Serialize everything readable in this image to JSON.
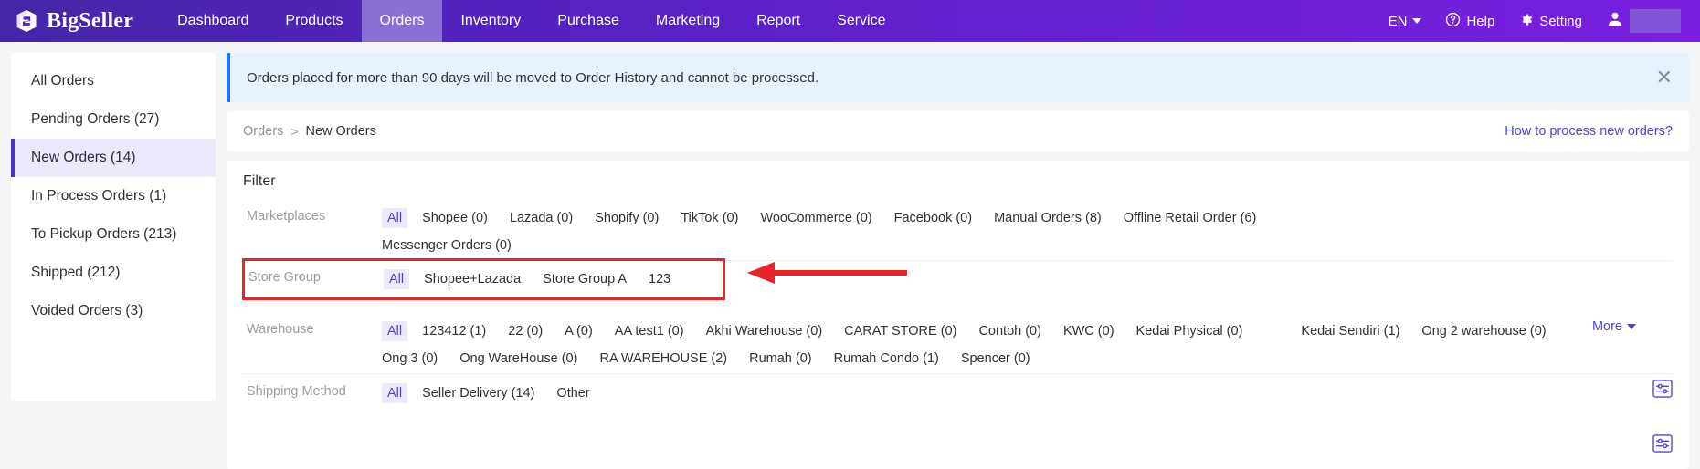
{
  "topnav": {
    "brand": "BigSeller",
    "brand_logo_icon": "bigseller-logo-icon",
    "items": [
      {
        "label": "Dashboard",
        "active": false
      },
      {
        "label": "Products",
        "active": false
      },
      {
        "label": "Orders",
        "active": true
      },
      {
        "label": "Inventory",
        "active": false
      },
      {
        "label": "Purchase",
        "active": false
      },
      {
        "label": "Marketing",
        "active": false
      },
      {
        "label": "Report",
        "active": false
      },
      {
        "label": "Service",
        "active": false
      }
    ],
    "language": "EN",
    "help": "Help",
    "setting": "Setting",
    "accent": "#5b21c9",
    "active_tab_bg": "#8a6fd4"
  },
  "sidebar": {
    "items": [
      {
        "label": "All Orders",
        "active": false
      },
      {
        "label": "Pending Orders (27)",
        "active": false
      },
      {
        "label": "New Orders (14)",
        "active": true
      },
      {
        "label": "In Process Orders (1)",
        "active": false
      },
      {
        "label": "To Pickup Orders (213)",
        "active": false
      },
      {
        "label": "Shipped (212)",
        "active": false
      },
      {
        "label": "Voided Orders (3)",
        "active": false
      }
    ],
    "active_bg": "#ece9fb",
    "active_bar": "#4c31c4"
  },
  "notice": {
    "text": "Orders placed for more than 90 days will be moved to Order History and cannot be processed.",
    "close_icon": "close-icon",
    "bg": "#e8f2fe",
    "bar": "#1677ff"
  },
  "breadcrumb": {
    "parent": "Orders",
    "separator": ">",
    "current": "New Orders",
    "help_link": "How to process new orders?",
    "link_color": "#4a45d8"
  },
  "filter": {
    "title": "Filter",
    "rows": [
      {
        "label": "Marketplaces",
        "options": [
          {
            "label": "All",
            "selected": true
          },
          {
            "label": "Shopee (0)",
            "selected": false
          },
          {
            "label": "Lazada (0)",
            "selected": false
          },
          {
            "label": "Shopify (0)",
            "selected": false
          },
          {
            "label": "TikTok (0)",
            "selected": false
          },
          {
            "label": "WooCommerce (0)",
            "selected": false
          },
          {
            "label": "Facebook (0)",
            "selected": false
          },
          {
            "label": "Manual Orders (8)",
            "selected": false
          },
          {
            "label": "Offline Retail Order (6)",
            "selected": false
          },
          {
            "label": "Messenger Orders (0)",
            "selected": false
          }
        ]
      },
      {
        "label": "Store Group",
        "highlighted": true,
        "highlight_color": "#e8232a",
        "options": [
          {
            "label": "All",
            "selected": true
          },
          {
            "label": "Shopee+Lazada",
            "selected": false
          },
          {
            "label": "Store Group A",
            "selected": false
          },
          {
            "label": "123",
            "selected": false
          }
        ]
      },
      {
        "label": "Warehouse",
        "more_label": "More",
        "options": [
          {
            "label": "All",
            "selected": true
          },
          {
            "label": "123412 (1)",
            "selected": false
          },
          {
            "label": "22 (0)",
            "selected": false
          },
          {
            "label": "A (0)",
            "selected": false
          },
          {
            "label": "AA test1 (0)",
            "selected": false
          },
          {
            "label": "Akhi Warehouse (0)",
            "selected": false
          },
          {
            "label": "CARAT STORE (0)",
            "selected": false
          },
          {
            "label": "Contoh (0)",
            "selected": false
          },
          {
            "label": "KWC (0)",
            "selected": false
          },
          {
            "label": "Kedai Physical (0)",
            "selected": false
          },
          {
            "label": "Kedai Sendiri (1)",
            "selected": false
          },
          {
            "label": "Ong 2 warehouse (0)",
            "selected": false
          },
          {
            "label": "Ong 3 (0)",
            "selected": false
          },
          {
            "label": "Ong WareHouse (0)",
            "selected": false
          },
          {
            "label": "RA WAREHOUSE (2)",
            "selected": false
          },
          {
            "label": "Rumah (0)",
            "selected": false
          },
          {
            "label": "Rumah Condo (1)",
            "selected": false
          },
          {
            "label": "Spencer (0)",
            "selected": false
          }
        ]
      },
      {
        "label": "Shipping Method",
        "options": [
          {
            "label": "All",
            "selected": true
          },
          {
            "label": "Seller Delivery (14)",
            "selected": false
          },
          {
            "label": "Other",
            "selected": false
          }
        ]
      }
    ],
    "row_settings_icon": "filter-settings-icon",
    "selected_bg": "#ece9fb",
    "selected_fg": "#4a45d8"
  },
  "annotation": {
    "arrow_icon": "red-arrow-left-icon",
    "color": "#e8232a"
  }
}
